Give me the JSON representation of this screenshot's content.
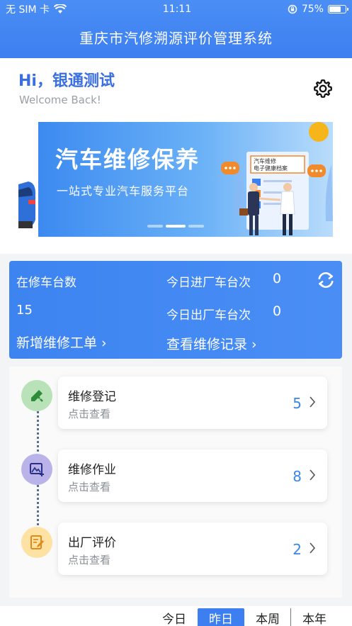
{
  "status_bar": {
    "carrier": "无 SIM 卡",
    "time": "11:11",
    "battery": "75%",
    "battery_level": 0.75
  },
  "app": {
    "title": "重庆市汽修溯源评价管理系统"
  },
  "welcome": {
    "greeting": "Hi，银通测试",
    "subtitle": "Welcome Back!"
  },
  "banner": {
    "title": "汽车维修保养",
    "subtitle": "一站式专业汽车服务平台",
    "doc_label_1": "汽车维修",
    "doc_label_2": "电子健康档案"
  },
  "stats": {
    "in_repair_label": "在修车台数",
    "in_repair_value": "15",
    "today_in_label": "今日进厂车台次",
    "today_in_value": "0",
    "today_out_label": "今日出厂车台次",
    "today_out_value": "0",
    "new_order_link": "新增维修工单 ›",
    "records_link": "查看维修记录 ›"
  },
  "steps": [
    {
      "title": "维修登记",
      "hint": "点击查看",
      "count": "5",
      "icon": "pencil-ruler-icon",
      "color": "#b9e2b9"
    },
    {
      "title": "维修作业",
      "hint": "点击查看",
      "count": "8",
      "icon": "image-upload-icon",
      "color": "#b9b3ea"
    },
    {
      "title": "出厂评价",
      "hint": "点击查看",
      "count": "2",
      "icon": "document-edit-icon",
      "color": "#fde2a4"
    }
  ],
  "periods": {
    "items": [
      "今日",
      "昨日",
      "本周",
      "本年"
    ],
    "active": "昨日"
  },
  "colors": {
    "primary": "#3d7ff0",
    "count": "#3a86e8"
  }
}
